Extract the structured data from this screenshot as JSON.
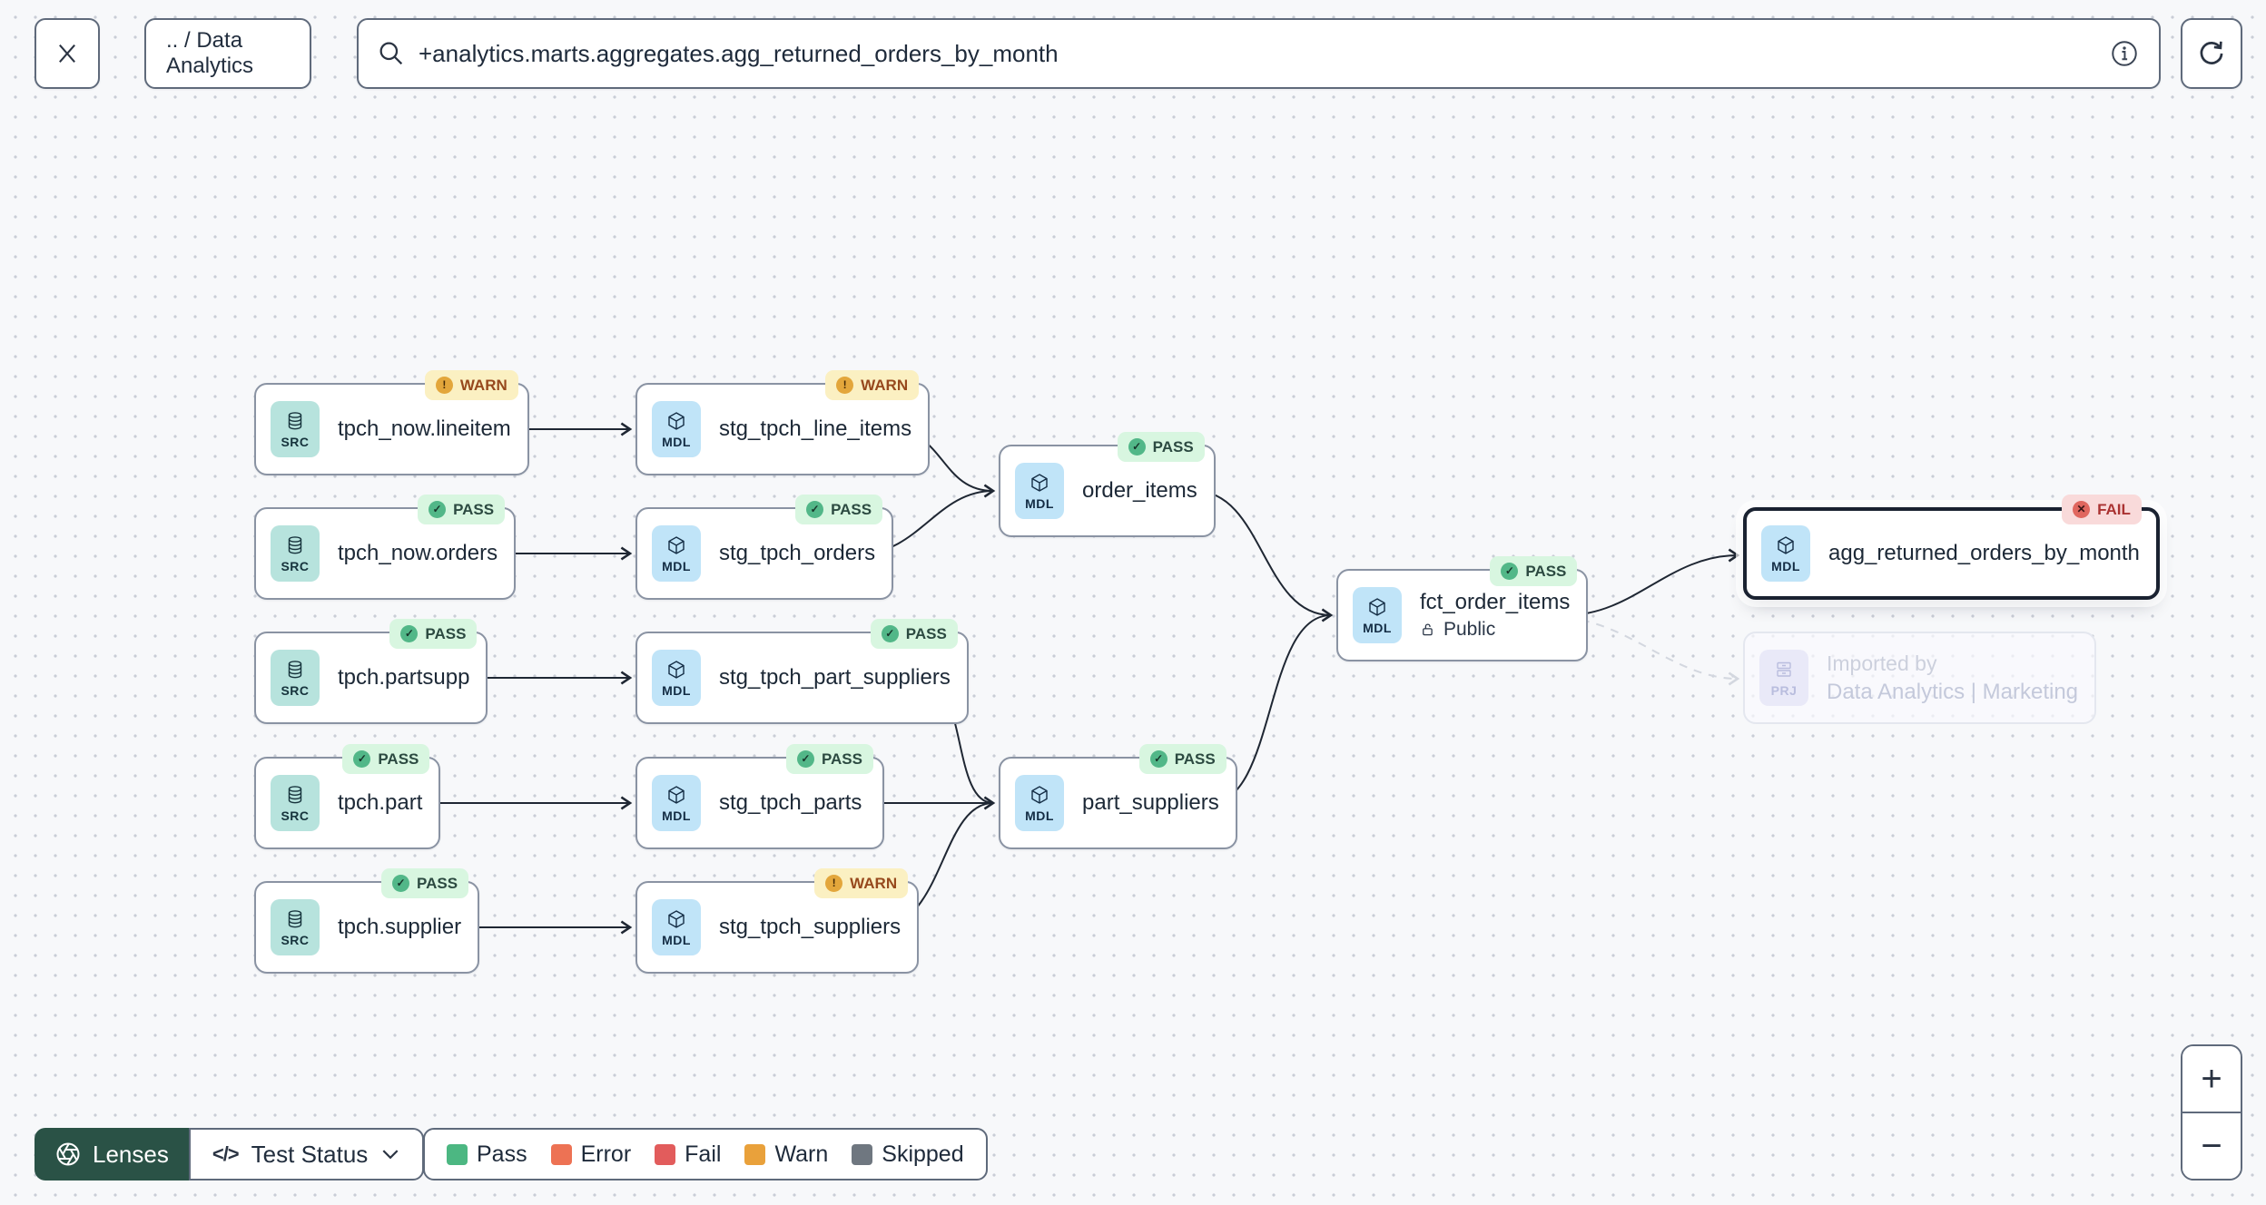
{
  "toolbar": {
    "breadcrumb": ".. / Data Analytics",
    "search_value": "+analytics.marts.aggregates.agg_returned_orders_by_month"
  },
  "icons": {
    "check": "✓",
    "exclaim": "!",
    "cross": "✕",
    "code": "</>"
  },
  "zoom_controls": {
    "zoom_in": "+",
    "zoom_out": "−"
  },
  "lens_bar": {
    "lenses_label": "Lenses",
    "selected_lens": "Test Status"
  },
  "legend": {
    "items": [
      {
        "label": "Pass",
        "color": "#4cb782"
      },
      {
        "label": "Error",
        "color": "#ed7254"
      },
      {
        "label": "Fail",
        "color": "#e25c5c"
      },
      {
        "label": "Warn",
        "color": "#e9a13b"
      },
      {
        "label": "Skipped",
        "color": "#6f7780"
      }
    ]
  },
  "selected_node": "agg_returned_orders_by_month",
  "nodes": [
    {
      "label": "tpch_now.lineitem",
      "type_label": "SRC",
      "status": "WARN"
    },
    {
      "label": "stg_tpch_line_items",
      "type_label": "MDL",
      "status": "WARN"
    },
    {
      "label": "tpch_now.orders",
      "type_label": "SRC",
      "status": "PASS"
    },
    {
      "label": "stg_tpch_orders",
      "type_label": "MDL",
      "status": "PASS"
    },
    {
      "label": "order_items",
      "type_label": "MDL",
      "status": "PASS"
    },
    {
      "label": "tpch.partsupp",
      "type_label": "SRC",
      "status": "PASS"
    },
    {
      "label": "stg_tpch_part_suppliers",
      "type_label": "MDL",
      "status": "PASS"
    },
    {
      "label": "tpch.part",
      "type_label": "SRC",
      "status": "PASS"
    },
    {
      "label": "stg_tpch_parts",
      "type_label": "MDL",
      "status": "PASS"
    },
    {
      "label": "part_suppliers",
      "type_label": "MDL",
      "status": "PASS"
    },
    {
      "label": "tpch.supplier",
      "type_label": "SRC",
      "status": "PASS"
    },
    {
      "label": "stg_tpch_suppliers",
      "type_label": "MDL",
      "status": "WARN"
    },
    {
      "label": "fct_order_items",
      "type_label": "MDL",
      "status": "PASS",
      "sublabel": "Public"
    },
    {
      "label": "agg_returned_orders_by_month",
      "type_label": "MDL",
      "status": "FAIL",
      "selected": true
    },
    {
      "label_line1": "Imported by",
      "label_line2": "Data Analytics | Marketing",
      "type_label": "PRJ"
    }
  ],
  "edges": [
    {
      "from": "tpch_now.lineitem",
      "to": "stg_tpch_line_items"
    },
    {
      "from": "tpch_now.orders",
      "to": "stg_tpch_orders"
    },
    {
      "from": "tpch.partsupp",
      "to": "stg_tpch_part_suppliers"
    },
    {
      "from": "tpch.part",
      "to": "stg_tpch_parts"
    },
    {
      "from": "tpch.supplier",
      "to": "stg_tpch_suppliers"
    },
    {
      "from": "stg_tpch_line_items",
      "to": "order_items"
    },
    {
      "from": "stg_tpch_orders",
      "to": "order_items"
    },
    {
      "from": "stg_tpch_part_suppliers",
      "to": "part_suppliers"
    },
    {
      "from": "stg_tpch_parts",
      "to": "part_suppliers"
    },
    {
      "from": "stg_tpch_suppliers",
      "to": "part_suppliers"
    },
    {
      "from": "order_items",
      "to": "fct_order_items"
    },
    {
      "from": "part_suppliers",
      "to": "fct_order_items"
    },
    {
      "from": "fct_order_items",
      "to": "agg_returned_orders_by_month"
    },
    {
      "from": "fct_order_items",
      "to": "Data Analytics | Marketing",
      "style": "dashed"
    }
  ]
}
